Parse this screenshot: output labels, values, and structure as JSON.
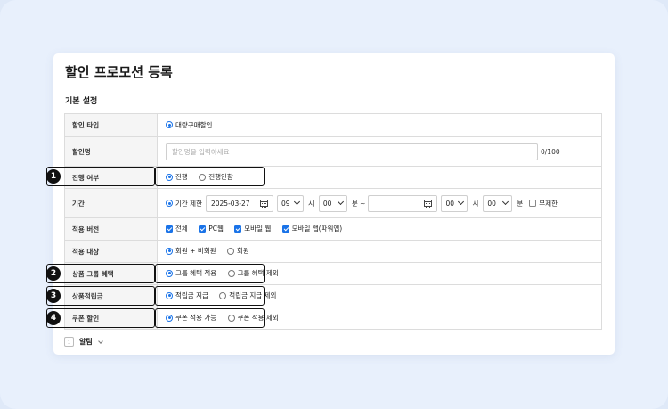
{
  "page_title": "할인 프로모션 등록",
  "section_title": "기본 설정",
  "rows": {
    "discount_type": {
      "label": "할인 타입",
      "option": "대량구매할인"
    },
    "discount_name": {
      "label": "할인명",
      "placeholder": "할인명을 입력하세요",
      "counter": "0/100"
    },
    "progress": {
      "label": "진행 여부",
      "options": [
        "진행",
        "진행안함"
      ]
    },
    "period": {
      "label": "기간",
      "limit_label": "기간 제한",
      "start_date": "2025-03-27",
      "start_hour": "09",
      "hour_unit": "시",
      "start_minute": "00",
      "minute_unit_tilde": "분 ~",
      "end_date": "",
      "end_hour": "00",
      "end_minute": "00",
      "minute_unit": "분",
      "unlimited_label": "무제한"
    },
    "apply_version": {
      "label": "적용 버전",
      "options": [
        "전체",
        "PC웹",
        "모바일 웹",
        "모바일 앱(파워앱)"
      ]
    },
    "apply_target": {
      "label": "적용 대상",
      "options": [
        "회원 + 비회원",
        "회원"
      ]
    },
    "group_benefit": {
      "label": "상품 그룹 혜택",
      "options": [
        "그룹 혜택 적용",
        "그룹 혜택 제외"
      ]
    },
    "reward_points": {
      "label": "상품적립금",
      "options": [
        "적립금 지급",
        "적립금 지급 제외"
      ]
    },
    "coupon_discount": {
      "label": "쿠폰 할인",
      "options": [
        "쿠폰 적용 가능",
        "쿠폰 적용 제외"
      ]
    }
  },
  "callouts": [
    "1",
    "2",
    "3",
    "4"
  ],
  "footer": {
    "info_icon_text": "i",
    "label": "알림"
  },
  "colors": {
    "accent": "#1a73e8",
    "header_bg": "#f5f5f5",
    "page_bg": "#e8f0fc"
  }
}
